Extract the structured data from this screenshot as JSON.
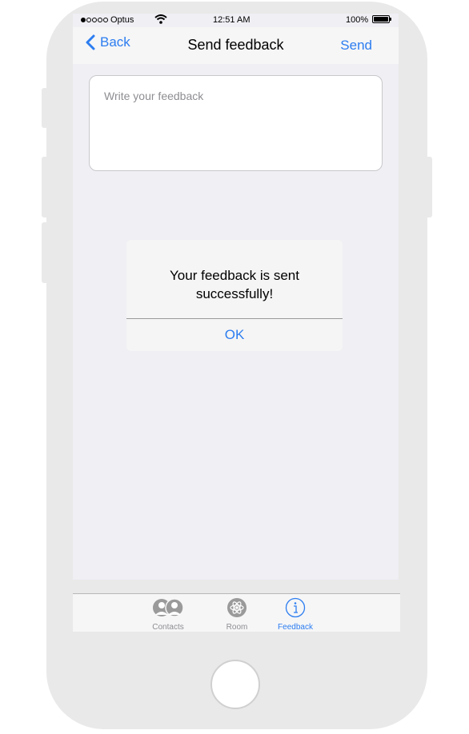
{
  "status_bar": {
    "carrier": "Optus",
    "time": "12:51 AM",
    "battery": "100%"
  },
  "nav": {
    "back_label": "Back",
    "title": "Send feedback",
    "send_label": "Send"
  },
  "feedback": {
    "placeholder": "Write your feedback"
  },
  "alert": {
    "line1": "Your feedback is sent",
    "line2": "successfully!",
    "ok_label": "OK"
  },
  "tabs": [
    {
      "label": "Contacts",
      "icon": "contacts-icon",
      "active": false
    },
    {
      "label": "Room",
      "icon": "atom-icon",
      "active": false
    },
    {
      "label": "Feedback",
      "icon": "info-icon",
      "active": true
    }
  ],
  "colors": {
    "accent": "#2c7df0",
    "inactive": "#8e8e93",
    "phone_body": "#e9e9e9",
    "screen_bg": "#efeff4"
  }
}
